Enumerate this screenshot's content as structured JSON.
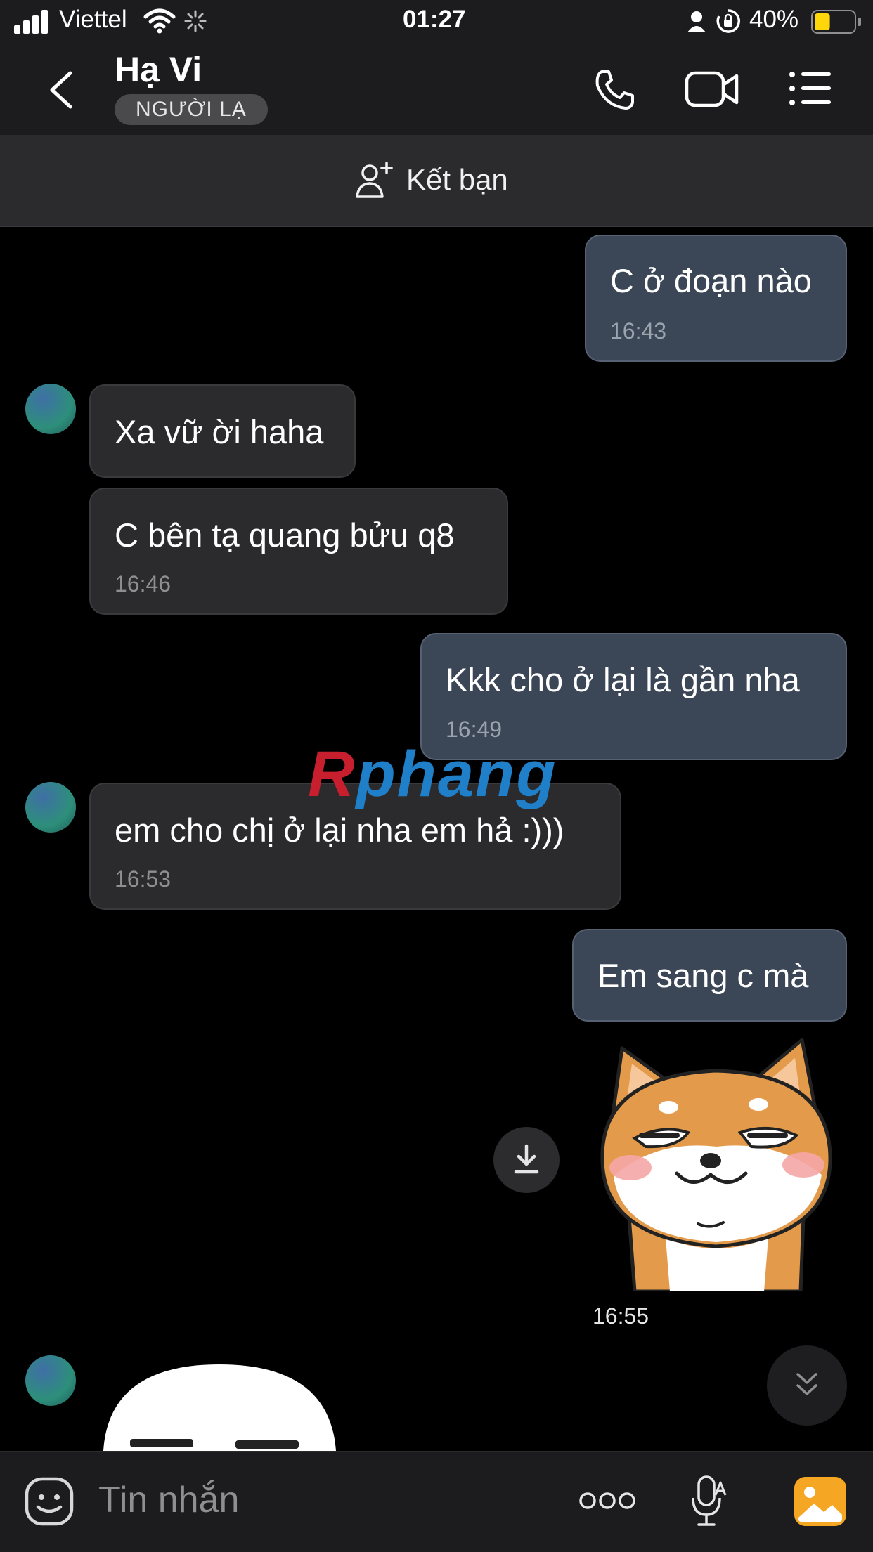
{
  "status_bar": {
    "carrier": "Viettel",
    "time": "01:27",
    "battery": "40%",
    "battery_level": 0.4
  },
  "header": {
    "title": "Hạ Vi",
    "badge": "NGƯỜI LẠ"
  },
  "add_friend": {
    "label": "Kết bạn"
  },
  "messages": [
    {
      "side": "out",
      "text": "C ở đoạn nào",
      "time": "16:43"
    },
    {
      "side": "in",
      "text": "Xa vữ ời haha",
      "time": ""
    },
    {
      "side": "in",
      "text": "C bên tạ quang bửu q8",
      "time": "16:46"
    },
    {
      "side": "out",
      "text": "Kkk cho ở lại là gần nha",
      "time": "16:49"
    },
    {
      "side": "in",
      "text": "em cho chị ở lại nha em hả :)))",
      "time": "16:53"
    },
    {
      "side": "out",
      "text": "Em sang c mà",
      "time": ""
    },
    {
      "side": "out",
      "type": "sticker",
      "sticker": "shiba-dog-sticker",
      "time": "16:55"
    }
  ],
  "watermark": {
    "part1": "R",
    "part2": "phang"
  },
  "input": {
    "placeholder": "Tin nhắn"
  },
  "colors": {
    "outgoing_bubble": "#3b4656",
    "incoming_bubble": "#2b2b2d",
    "battery_fill": "#ffd60a",
    "gallery_icon": "#f5a623"
  }
}
